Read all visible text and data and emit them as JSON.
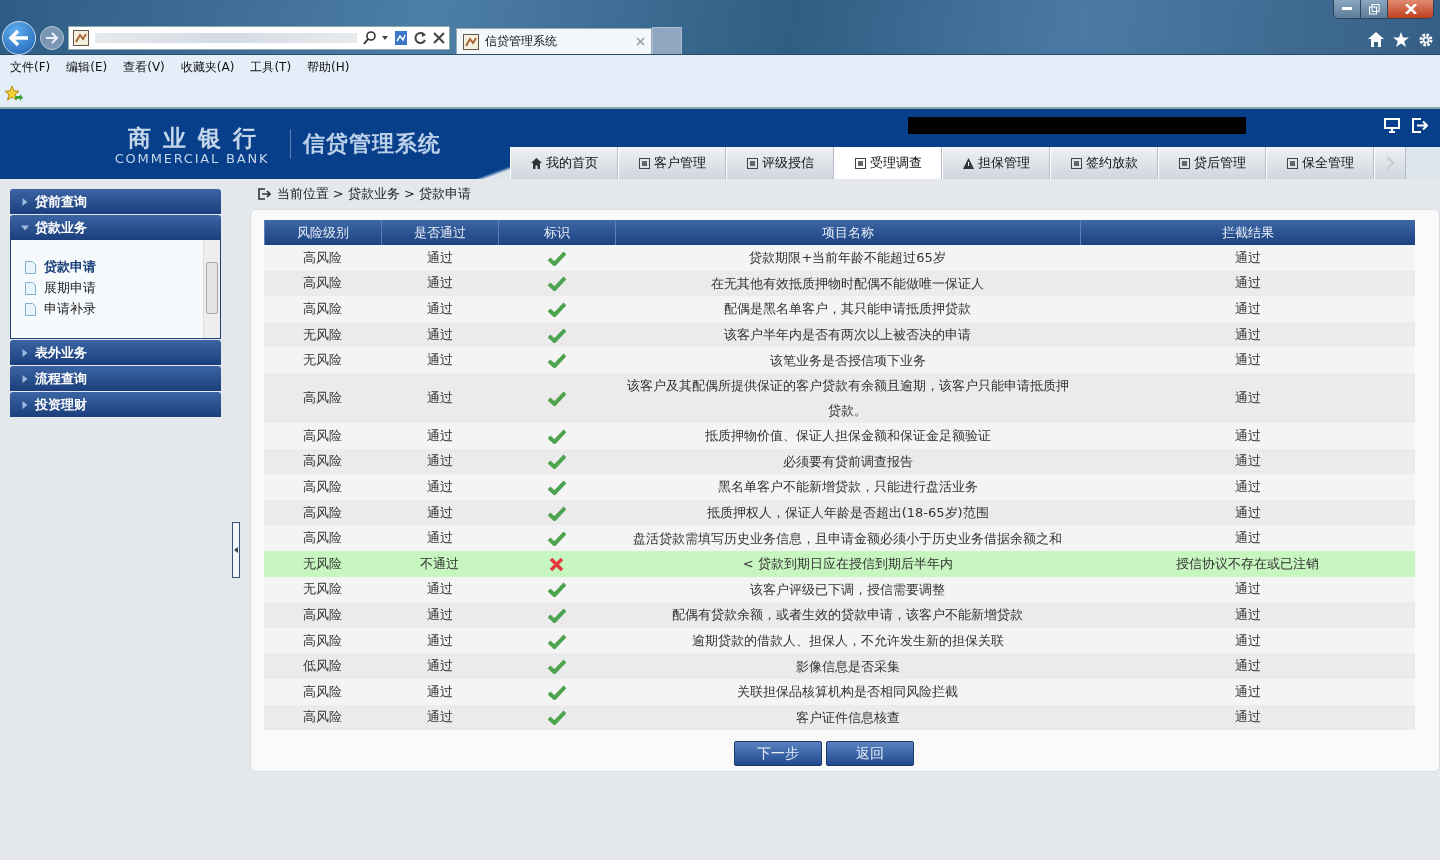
{
  "browser": {
    "tabs": [
      {
        "title": "信贷管理系统",
        "selected": true
      }
    ],
    "menu": [
      "文件(F)",
      "编辑(E)",
      "查看(V)",
      "收藏夹(A)",
      "工具(T)",
      "帮助(H)"
    ]
  },
  "header": {
    "logo_cn": "商业银行",
    "logo_en": "COMMERCIAL BANK",
    "system_name": "信贷管理系统"
  },
  "nav_tabs": [
    {
      "label": "我的首页",
      "selected": false
    },
    {
      "label": "客户管理",
      "selected": false
    },
    {
      "label": "评级授信",
      "selected": false
    },
    {
      "label": "受理调查",
      "selected": true
    },
    {
      "label": "担保管理",
      "selected": false
    },
    {
      "label": "签约放款",
      "selected": false
    },
    {
      "label": "贷后管理",
      "selected": false
    },
    {
      "label": "保全管理",
      "selected": false
    }
  ],
  "sidebar": [
    {
      "label": "贷前查询",
      "expanded": false
    },
    {
      "label": "贷款业务",
      "expanded": true,
      "children": [
        {
          "label": "贷款申请",
          "selected": true
        },
        {
          "label": "展期申请",
          "selected": false
        },
        {
          "label": "申请补录",
          "selected": false
        }
      ]
    },
    {
      "label": "表外业务",
      "expanded": false
    },
    {
      "label": "流程查询",
      "expanded": false
    },
    {
      "label": "投资理财",
      "expanded": false
    }
  ],
  "breadcrumb": "当前位置 > 贷款业务 > 贷款申请",
  "table": {
    "columns": [
      "风险级别",
      "是否通过",
      "标识",
      "项目名称",
      "拦截结果"
    ],
    "rows": [
      {
        "risk": "高风险",
        "pass": "通过",
        "ok": true,
        "name": "贷款期限+当前年龄不能超过65岁",
        "result": "通过"
      },
      {
        "risk": "高风险",
        "pass": "通过",
        "ok": true,
        "name": "在无其他有效抵质押物时配偶不能做唯一保证人",
        "result": "通过"
      },
      {
        "risk": "高风险",
        "pass": "通过",
        "ok": true,
        "name": "配偶是黑名单客户，其只能申请抵质押贷款",
        "result": "通过"
      },
      {
        "risk": "无风险",
        "pass": "通过",
        "ok": true,
        "name": "该客户半年内是否有两次以上被否决的申请",
        "result": "通过"
      },
      {
        "risk": "无风险",
        "pass": "通过",
        "ok": true,
        "name": "该笔业务是否授信项下业务",
        "result": "通过"
      },
      {
        "risk": "高风险",
        "pass": "通过",
        "ok": true,
        "name": "该客户及其配偶所提供保证的客户贷款有余额且逾期，该客户只能申请抵质押贷款。",
        "result": "通过"
      },
      {
        "risk": "高风险",
        "pass": "通过",
        "ok": true,
        "name": "抵质押物价值、保证人担保金额和保证金足额验证",
        "result": "通过"
      },
      {
        "risk": "高风险",
        "pass": "通过",
        "ok": true,
        "name": "必须要有贷前调查报告",
        "result": "通过"
      },
      {
        "risk": "高风险",
        "pass": "通过",
        "ok": true,
        "name": "黑名单客户不能新增贷款，只能进行盘活业务",
        "result": "通过"
      },
      {
        "risk": "高风险",
        "pass": "通过",
        "ok": true,
        "name": "抵质押权人，保证人年龄是否超出(18-65岁)范围",
        "result": "通过"
      },
      {
        "risk": "高风险",
        "pass": "通过",
        "ok": true,
        "name": "盘活贷款需填写历史业务信息，且申请金额必须小于历史业务借据余额之和",
        "result": "通过"
      },
      {
        "risk": "无风险",
        "pass": "不通过",
        "ok": false,
        "name": "< 贷款到期日应在授信到期后半年内",
        "result": "授信协议不存在或已注销"
      },
      {
        "risk": "无风险",
        "pass": "通过",
        "ok": true,
        "name": "该客户评级已下调，授信需要调整",
        "result": "通过"
      },
      {
        "risk": "高风险",
        "pass": "通过",
        "ok": true,
        "name": "配偶有贷款余额，或者生效的贷款申请，该客户不能新增贷款",
        "result": "通过"
      },
      {
        "risk": "高风险",
        "pass": "通过",
        "ok": true,
        "name": "逾期贷款的借款人、担保人，不允许发生新的担保关联",
        "result": "通过"
      },
      {
        "risk": "低风险",
        "pass": "通过",
        "ok": true,
        "name": "影像信息是否采集",
        "result": "通过"
      },
      {
        "risk": "高风险",
        "pass": "通过",
        "ok": true,
        "name": "关联担保品核算机构是否相同风险拦截",
        "result": "通过"
      },
      {
        "risk": "高风险",
        "pass": "通过",
        "ok": true,
        "name": "客户证件信息核查",
        "result": "通过"
      }
    ]
  },
  "buttons": [
    "下一步",
    "返回"
  ]
}
